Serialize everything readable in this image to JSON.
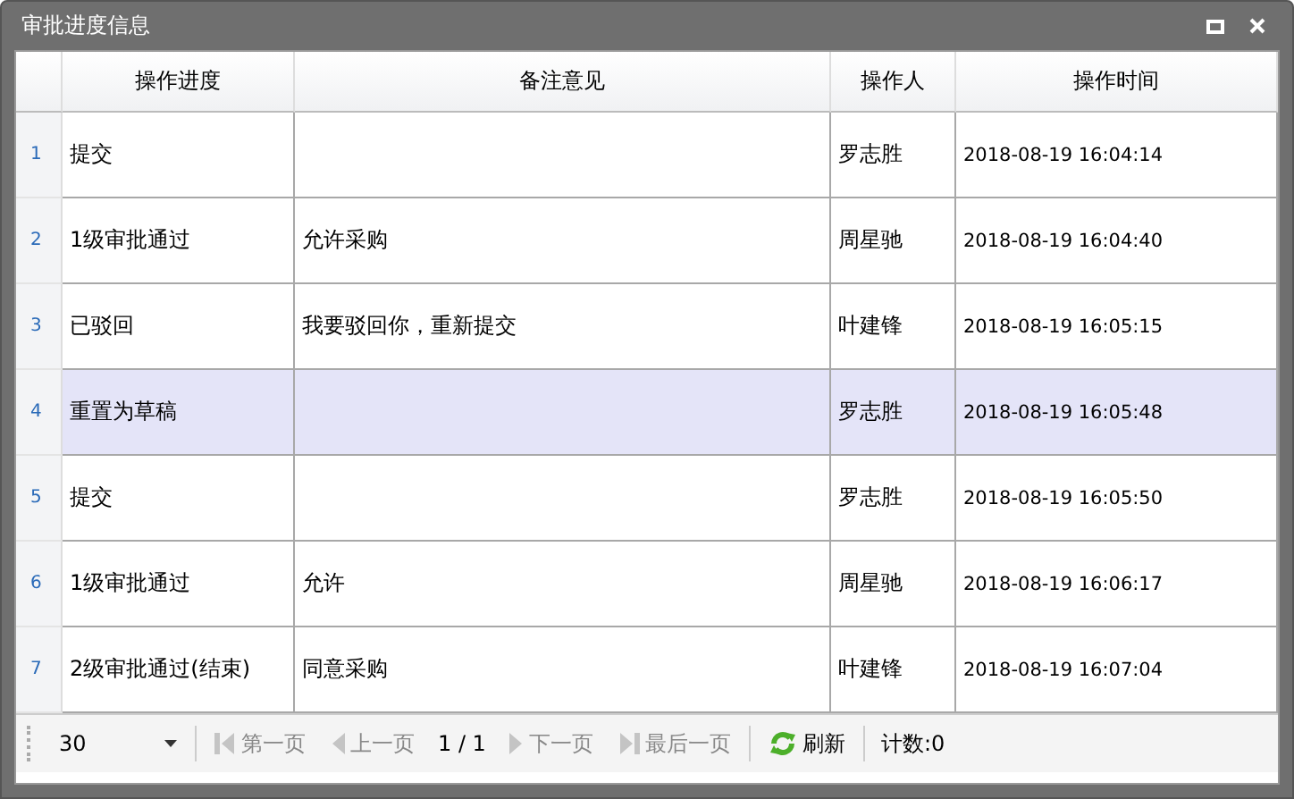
{
  "window": {
    "title": "审批进度信息"
  },
  "table": {
    "columns": [
      "操作进度",
      "备注意见",
      "操作人",
      "操作时间"
    ],
    "rows": [
      {
        "number": "1",
        "cells": [
          "提交",
          "",
          "罗志胜",
          "2018-08-19 16:04:14"
        ],
        "selected": false
      },
      {
        "number": "2",
        "cells": [
          "1级审批通过",
          "允许采购",
          "周星驰",
          "2018-08-19 16:04:40"
        ],
        "selected": false
      },
      {
        "number": "3",
        "cells": [
          "已驳回",
          "我要驳回你，重新提交",
          "叶建锋",
          "2018-08-19 16:05:15"
        ],
        "selected": false
      },
      {
        "number": "4",
        "cells": [
          "重置为草稿",
          "",
          "罗志胜",
          "2018-08-19 16:05:48"
        ],
        "selected": true
      },
      {
        "number": "5",
        "cells": [
          "提交",
          "",
          "罗志胜",
          "2018-08-19 16:05:50"
        ],
        "selected": false
      },
      {
        "number": "6",
        "cells": [
          "1级审批通过",
          "允许",
          "周星驰",
          "2018-08-19 16:06:17"
        ],
        "selected": false
      },
      {
        "number": "7",
        "cells": [
          "2级审批通过(结束)",
          "同意采购",
          "叶建锋",
          "2018-08-19 16:07:04"
        ],
        "selected": false
      }
    ]
  },
  "pager": {
    "page_size": "30",
    "nav": [
      {
        "kind": "first",
        "label": "第一页",
        "disabled": true
      },
      {
        "kind": "prev",
        "label": "上一页",
        "disabled": true
      },
      {
        "kind": "page",
        "label": "1 / 1"
      },
      {
        "kind": "next",
        "label": "下一页",
        "disabled": true
      },
      {
        "kind": "last",
        "label": "最后一页",
        "disabled": true
      },
      {
        "kind": "sep"
      },
      {
        "kind": "refresh",
        "label": "刷新",
        "disabled": false
      },
      {
        "kind": "sep"
      },
      {
        "kind": "count",
        "label": "计数:0"
      }
    ]
  }
}
